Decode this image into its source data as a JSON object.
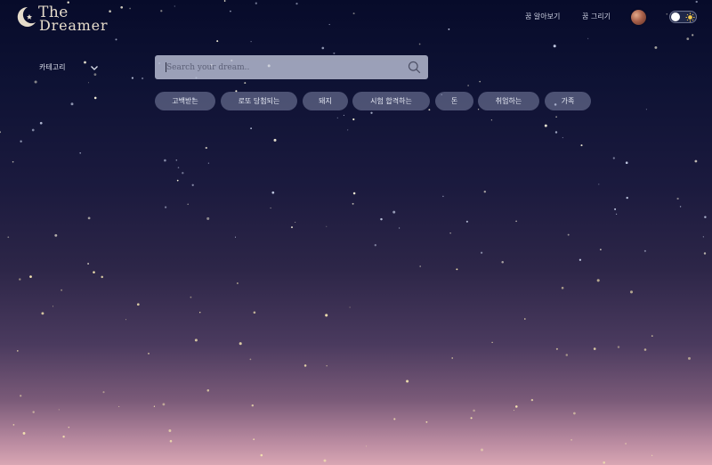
{
  "brand": {
    "line1": "The",
    "line2": "Dreamer"
  },
  "nav": {
    "items": [
      "꿈 알아보기",
      "꿈 그리기"
    ]
  },
  "category": {
    "label": "카테고리"
  },
  "search": {
    "placeholder": "Search your dream.."
  },
  "tags": [
    "고백받는",
    "로또 당첨되는",
    "돼지",
    "시험 합격하는",
    "돈",
    "취업하는",
    "가족"
  ],
  "colors": {
    "sky_top": "#070b2a",
    "sky_bottom": "#d8a6b3",
    "star": "#f3e3b0",
    "tag_bg": "#7e85a8",
    "search_bg": "#c4c9de"
  },
  "icons": {
    "logo": "crescent-moon-star-icon",
    "search": "magnifier-icon",
    "category": "chevron-down-icon",
    "theme": "sun-icon"
  }
}
